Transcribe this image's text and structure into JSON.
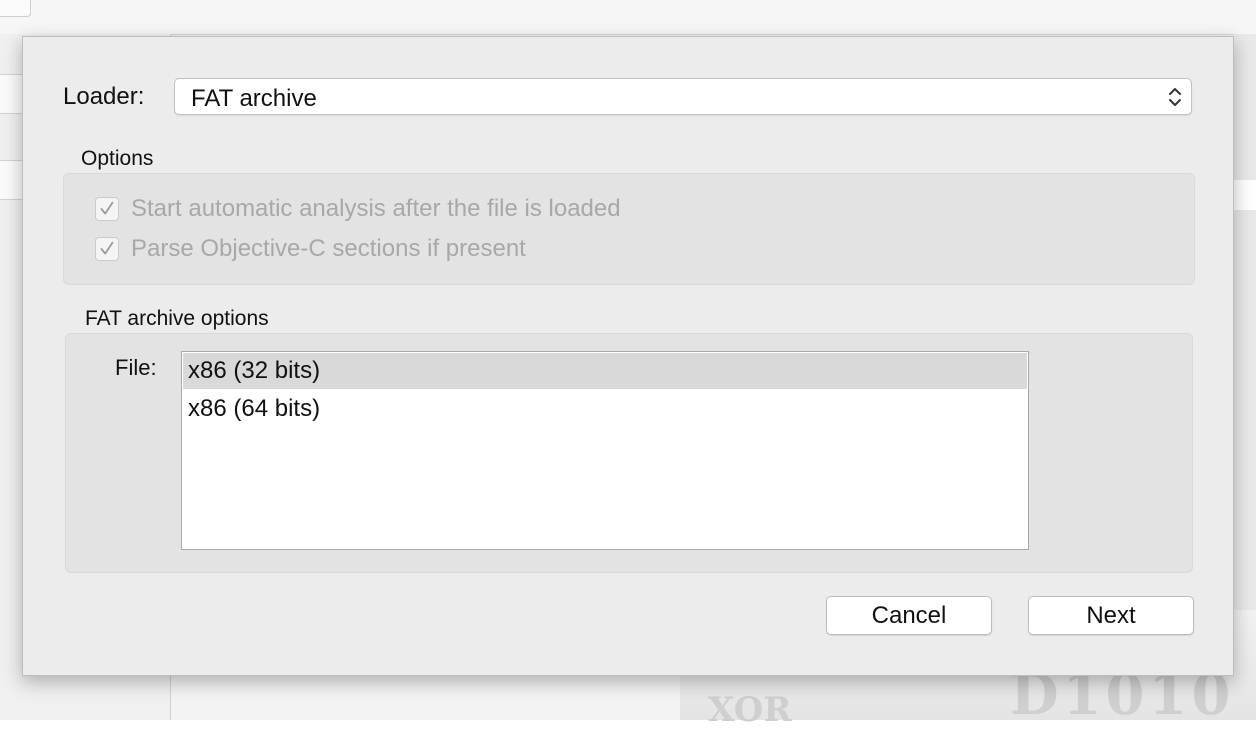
{
  "dialog": {
    "loader_label": "Loader:",
    "loader_value": "FAT archive",
    "options_title": "Options",
    "options": [
      {
        "label": "Start automatic analysis after the file is loaded",
        "checked": true
      },
      {
        "label": "Parse Objective-C sections if present",
        "checked": true
      }
    ],
    "fat_options_title": "FAT archive options",
    "file_label": "File:",
    "files": [
      {
        "label": "x86 (32 bits)",
        "selected": true
      },
      {
        "label": "x86 (64 bits)",
        "selected": false
      }
    ],
    "cancel_label": "Cancel",
    "next_label": "Next"
  },
  "background": {
    "art_text_1": "D1010",
    "art_text_2": "XOR"
  },
  "colors": {
    "sheet_bg": "#ececec",
    "group_bg": "#e3e3e3",
    "disabled_text": "#a8a8a8",
    "selection": "#d9d9d9"
  },
  "icons": {
    "select_arrows": "updown-chevron-icon",
    "checkbox_mark": "checkmark-icon"
  }
}
